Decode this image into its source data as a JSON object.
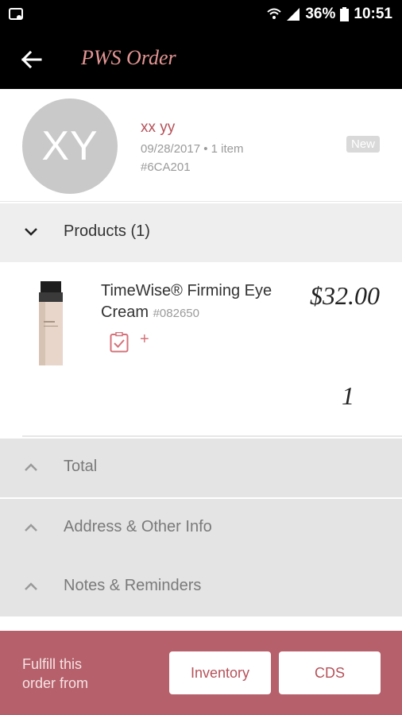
{
  "status_bar": {
    "battery": "36%",
    "time": "10:51"
  },
  "app_bar": {
    "title": "PWS Order"
  },
  "customer": {
    "initials": "XY",
    "name": "xx yy",
    "meta": "09/28/2017 • 1 item",
    "order_id": "#6CA201",
    "badge": "New"
  },
  "products_section": {
    "label": "Products (1)",
    "items": [
      {
        "name": "TimeWise® Firming Eye Cream",
        "sku": "#082650",
        "price": "$32.00",
        "quantity": "1"
      }
    ]
  },
  "sections": {
    "total": "Total",
    "address": "Address & Other Info",
    "notes": "Notes & Reminders"
  },
  "footer": {
    "text": "Fulfill this order from",
    "inventory_label": "Inventory",
    "cds_label": "CDS"
  },
  "colors": {
    "accent": "#b5525a",
    "footer_bg": "#b5606a",
    "title": "#e49694"
  }
}
